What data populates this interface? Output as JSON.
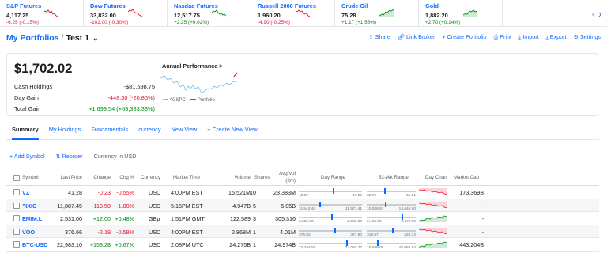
{
  "tickers": [
    {
      "name": "S&P Futures",
      "price": "4,117.25",
      "change": "-6.25 (-0.15%)",
      "dir": "down"
    },
    {
      "name": "Dow Futures",
      "price": "33,832.00",
      "change": "-102.00 (-0.30%)",
      "dir": "down"
    },
    {
      "name": "Nasdaq Futures",
      "price": "12,517.75",
      "change": "+2.25 (+0.02%)",
      "dir": "up"
    },
    {
      "name": "Russell 2000 Futures",
      "price": "1,960.20",
      "change": "-4.90 (-0.25%)",
      "dir": "down"
    },
    {
      "name": "Crude Oil",
      "price": "75.28",
      "change": "+1.17 (+1.58%)",
      "dir": "up"
    },
    {
      "name": "Gold",
      "price": "1,882.20",
      "change": "+2.70 (+0.14%)",
      "dir": "up"
    }
  ],
  "header": {
    "my_portfolios": "My Portfolios",
    "separator": "/",
    "portfolio_name": "Test 1",
    "actions": {
      "share": "Share",
      "link_broker": "Link Broker",
      "create_portfolio": "+ Create Portfolio",
      "print": "Print",
      "import": "Import",
      "export": "Export",
      "settings": "Settings"
    }
  },
  "summary": {
    "total": "$1,702.02",
    "cash_label": "Cash Holdings",
    "cash_value": "-$81,598.75",
    "day_gain_label": "Day Gain",
    "day_gain_value": "-448.30 (-20.85%)",
    "total_gain_label": "Total Gain",
    "total_gain_value": "+1,699.54 (+68,383.33%)",
    "annual_title": "Annual Performance",
    "annual_arrow": ">",
    "legend_gspc": "^GSPC",
    "legend_portfolio": "Portfolio"
  },
  "colors": {
    "accent": "#0f69ff",
    "up": "#008a12",
    "down": "#eb0f29",
    "gspc": "#7ec3f0",
    "portfolio": "#e0266a"
  },
  "tabs": [
    "Summary",
    "My Holdings",
    "Fundamentals",
    "currency",
    "New View",
    "+ Create New View"
  ],
  "toolbar": {
    "add_symbol": "+ Add Symbol",
    "reorder": "Reorder",
    "currency_note": "Currency in USD"
  },
  "columns": {
    "symbol": "Symbol",
    "last_price": "Last Price",
    "change": "Change",
    "chg_pct": "Chg %",
    "currency": "Currency",
    "market_time": "Market Time",
    "volume": "Volume",
    "shares": "Shares",
    "avg_vol": "Avg Vol",
    "avg_vol_sub": "(3m)",
    "day_range": "Day Range",
    "wk52_range": "52-Wk Range",
    "day_chart": "Day Chart",
    "market_cap": "Market Cap"
  },
  "rows": [
    {
      "symbol": "VZ",
      "last": "41.28",
      "change": "-0.23",
      "pct": "-0.55%",
      "currency": "USD",
      "time": "4:00PM EST",
      "volume": "15.521M",
      "shares": "10",
      "avg_vol": "23.383M",
      "day_lo": "40.90",
      "day_hi": "41.59",
      "day_pos": 0.55,
      "wk_lo": "32.79",
      "wk_hi": "55.51",
      "wk_pos": 0.37,
      "trend": "down",
      "mcap": "173.369B"
    },
    {
      "symbol": "^IXIC",
      "last": "11,887.45",
      "change": "-119.50",
      "pct": "-1.00%",
      "currency": "USD",
      "time": "5:15PM EST",
      "volume": "4.947B",
      "shares": "5",
      "avg_vol": "5.05B",
      "day_lo": "11,843.48",
      "day_hi": "11,973.41",
      "day_pos": 0.34,
      "wk_lo": "10,088.83",
      "wk_hi": "14,646.90",
      "wk_pos": 0.39,
      "trend": "down",
      "mcap": "-"
    },
    {
      "symbol": "EMIM.L",
      "last": "2,531.00",
      "change": "+12.00",
      "pct": "+0.48%",
      "currency": "GBp",
      "time": "1:51PM GMT",
      "volume": "122,589",
      "shares": "3",
      "avg_vol": "305,316",
      "day_lo": "2,525.50",
      "day_hi": "2,536.00",
      "day_pos": 0.52,
      "wk_lo": "2,163.50",
      "wk_hi": "2,672.00",
      "wk_pos": 0.72,
      "trend": "up",
      "mcap": "-"
    },
    {
      "symbol": "VOO",
      "last": "376.66",
      "change": "-2.19",
      "pct": "-0.58%",
      "currency": "USD",
      "time": "4:00PM EST",
      "volume": "2.868M",
      "shares": "1",
      "avg_vol": "4.01M",
      "day_lo": "375.02",
      "day_hi": "377.90",
      "day_pos": 0.57,
      "wk_lo": "319.87",
      "wk_hi": "424.72",
      "wk_pos": 0.54,
      "trend": "down",
      "mcap": "-"
    },
    {
      "symbol": "BTC-USD",
      "last": "22,983.10",
      "change": "+153.28",
      "pct": "+0.67%",
      "currency": "USD",
      "time": "2:08PM UTC",
      "volume": "24.275B",
      "shares": "1",
      "avg_vol": "24.974B",
      "day_lo": "22,764.50",
      "day_hi": "23,050.77",
      "day_pos": 0.76,
      "wk_lo": "15,599.05",
      "wk_hi": "48,086.84",
      "wk_pos": 0.23,
      "trend": "up",
      "mcap": "443.204B"
    }
  ]
}
